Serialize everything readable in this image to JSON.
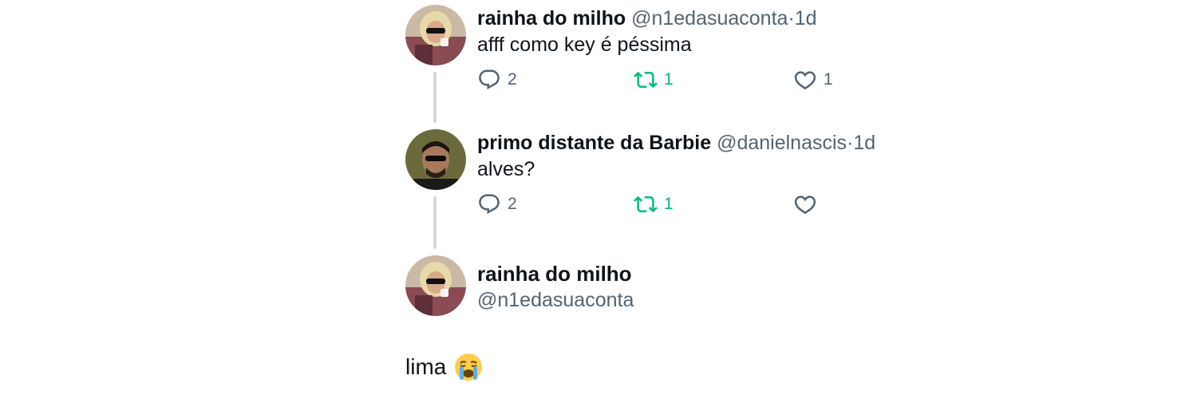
{
  "colors": {
    "retweet_green": "#00ba7c",
    "muted_gray": "#536471",
    "thread_line": "#cfd9de"
  },
  "tweets": [
    {
      "name": "rainha do milho",
      "handle": "@n1edasuaconta",
      "dot": "·",
      "time": "1d",
      "text": "afff como key é péssima",
      "replies": "2",
      "retweets": "1",
      "likes": "1",
      "avatar_icon": "avatar-woman-blonde-wig-sunglasses"
    },
    {
      "name": "primo distante da Barbie",
      "handle": "@danielnascis",
      "dot": "·",
      "time": "1d",
      "text": "alves?",
      "replies": "2",
      "retweets": "1",
      "likes": "",
      "avatar_icon": "avatar-man-sunglasses"
    }
  ],
  "main_tweet": {
    "name": "rainha do milho",
    "handle": "@n1edasuaconta",
    "text": "lima",
    "emoji_icon": "loudly-crying-face-emoji",
    "avatar_icon": "avatar-woman-blonde-wig-sunglasses"
  }
}
